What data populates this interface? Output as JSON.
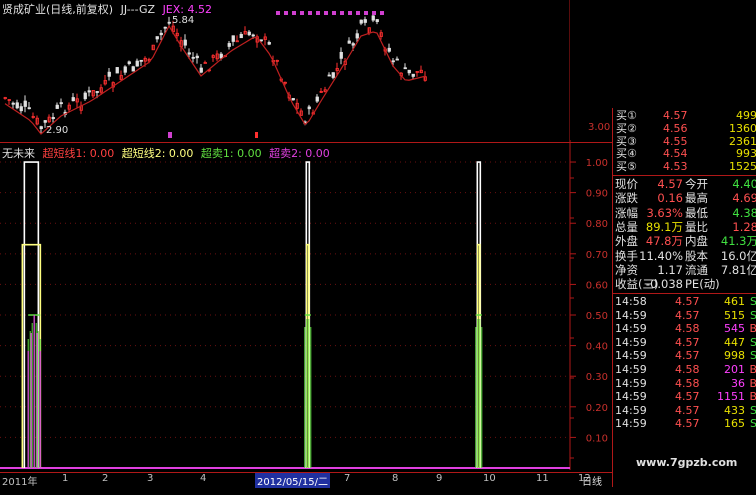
{
  "colors": {
    "background": "#000000",
    "axis": "#b01818",
    "up_candle": "#ff3030",
    "down_candle": "#e0e0e0",
    "ma_line": "#c02020",
    "signal_white": "#ffffff",
    "signal_yellow": "#ffff80",
    "signal_green": "#60e040",
    "signal_magenta": "#e040e0",
    "red": "#ff5050",
    "green": "#40e040",
    "yellow": "#e8e000"
  },
  "price_panel": {
    "title": "贤成矿业(日线,前复权)",
    "indicator_name": "JJ---GZ",
    "jex_label": "JEX: 4.52",
    "high_marker": "5.84",
    "low_marker": "2.90",
    "y_tick": "3.00"
  },
  "indicator_panel": {
    "name": "无未来",
    "legend": [
      {
        "label": "超短线1: 0.00",
        "color": "#ff4040"
      },
      {
        "label": "超短线2: 0.00",
        "color": "#ffff80"
      },
      {
        "label": "超卖1: 0.00",
        "color": "#60e040"
      },
      {
        "label": "超卖2: 0.00",
        "color": "#e040e0"
      }
    ],
    "y_ticks": [
      "1.00",
      "0.90",
      "0.80",
      "0.70",
      "0.60",
      "0.50",
      "0.40",
      "0.30",
      "0.20",
      "0.10"
    ]
  },
  "chart_data": {
    "type": "line",
    "title": "无未来",
    "ylim": [
      0,
      1.0
    ],
    "series": [
      {
        "name": "超短线1",
        "color": "#ffffff",
        "spikes": [
          {
            "pos": 0.055,
            "value": 1.0
          },
          {
            "pos": 0.54,
            "value": 1.0
          },
          {
            "pos": 0.84,
            "value": 1.0
          }
        ]
      },
      {
        "name": "超短线2",
        "color": "#ffff80",
        "spikes": [
          {
            "pos": 0.055,
            "value": 0.73
          },
          {
            "pos": 0.54,
            "value": 0.73
          },
          {
            "pos": 0.84,
            "value": 0.73
          }
        ]
      },
      {
        "name": "超卖1",
        "color": "#60e040",
        "spikes": [
          {
            "pos": 0.06,
            "value": 0.5
          },
          {
            "pos": 0.54,
            "value": 0.5
          },
          {
            "pos": 0.84,
            "value": 0.5
          }
        ]
      },
      {
        "name": "超卖2",
        "color": "#e040e0",
        "spikes": [
          {
            "pos": 0.06,
            "value": 0.5
          }
        ]
      }
    ]
  },
  "x_axis": {
    "labels": [
      "2011年",
      "1",
      "2",
      "3",
      "4",
      "2012/05/15/二",
      "7",
      "8",
      "9",
      "10",
      "11",
      "12"
    ],
    "period_button": "日线"
  },
  "quote": {
    "order_book": [
      {
        "label": "买①",
        "price": "4.57",
        "vol": "499"
      },
      {
        "label": "买②",
        "price": "4.56",
        "vol": "1360"
      },
      {
        "label": "买③",
        "price": "4.55",
        "vol": "2361"
      },
      {
        "label": "买④",
        "price": "4.54",
        "vol": "993"
      },
      {
        "label": "买⑤",
        "price": "4.53",
        "vol": "1525"
      }
    ],
    "stats": [
      {
        "l1": "现价",
        "v1": "4.57",
        "c1": "red",
        "l2": "今开",
        "v2": "4.40",
        "c2": "green"
      },
      {
        "l1": "涨跌",
        "v1": "0.16",
        "c1": "red",
        "l2": "最高",
        "v2": "4.69",
        "c2": "red"
      },
      {
        "l1": "涨幅",
        "v1": "3.63%",
        "c1": "red",
        "l2": "最低",
        "v2": "4.38",
        "c2": "green"
      },
      {
        "l1": "总量",
        "v1": "89.1万",
        "c1": "yellow",
        "l2": "量比",
        "v2": "1.28",
        "c2": "red"
      },
      {
        "l1": "外盘",
        "v1": "47.8万",
        "c1": "red",
        "l2": "内盘",
        "v2": "41.3万",
        "c2": "green"
      },
      {
        "l1": "换手",
        "v1": "11.40%",
        "c1": "white",
        "l2": "股本",
        "v2": "16.0亿",
        "c2": "white"
      },
      {
        "l1": "净资",
        "v1": "1.17",
        "c1": "white",
        "l2": "流通",
        "v2": "7.81亿",
        "c2": "white"
      },
      {
        "l1": "收益(三)",
        "v1": "-0.038",
        "c1": "white",
        "l2": "PE(动)",
        "v2": "",
        "c2": "white"
      }
    ],
    "ticks": [
      {
        "time": "14:58",
        "price": "4.57",
        "vol": "461",
        "side": "S"
      },
      {
        "time": "14:59",
        "price": "4.57",
        "vol": "515",
        "side": "S"
      },
      {
        "time": "14:59",
        "price": "4.58",
        "vol": "545",
        "side": "B"
      },
      {
        "time": "14:59",
        "price": "4.57",
        "vol": "447",
        "side": "S"
      },
      {
        "time": "14:59",
        "price": "4.57",
        "vol": "998",
        "side": "S"
      },
      {
        "time": "14:59",
        "price": "4.58",
        "vol": "201",
        "side": "B"
      },
      {
        "time": "14:59",
        "price": "4.58",
        "vol": "36",
        "side": "B"
      },
      {
        "time": "14:59",
        "price": "4.57",
        "vol": "1151",
        "side": "B"
      },
      {
        "time": "14:59",
        "price": "4.57",
        "vol": "433",
        "side": "S"
      },
      {
        "time": "14:59",
        "price": "4.57",
        "vol": "165",
        "side": "S"
      }
    ]
  },
  "watermark": "www.7gpzb.com"
}
